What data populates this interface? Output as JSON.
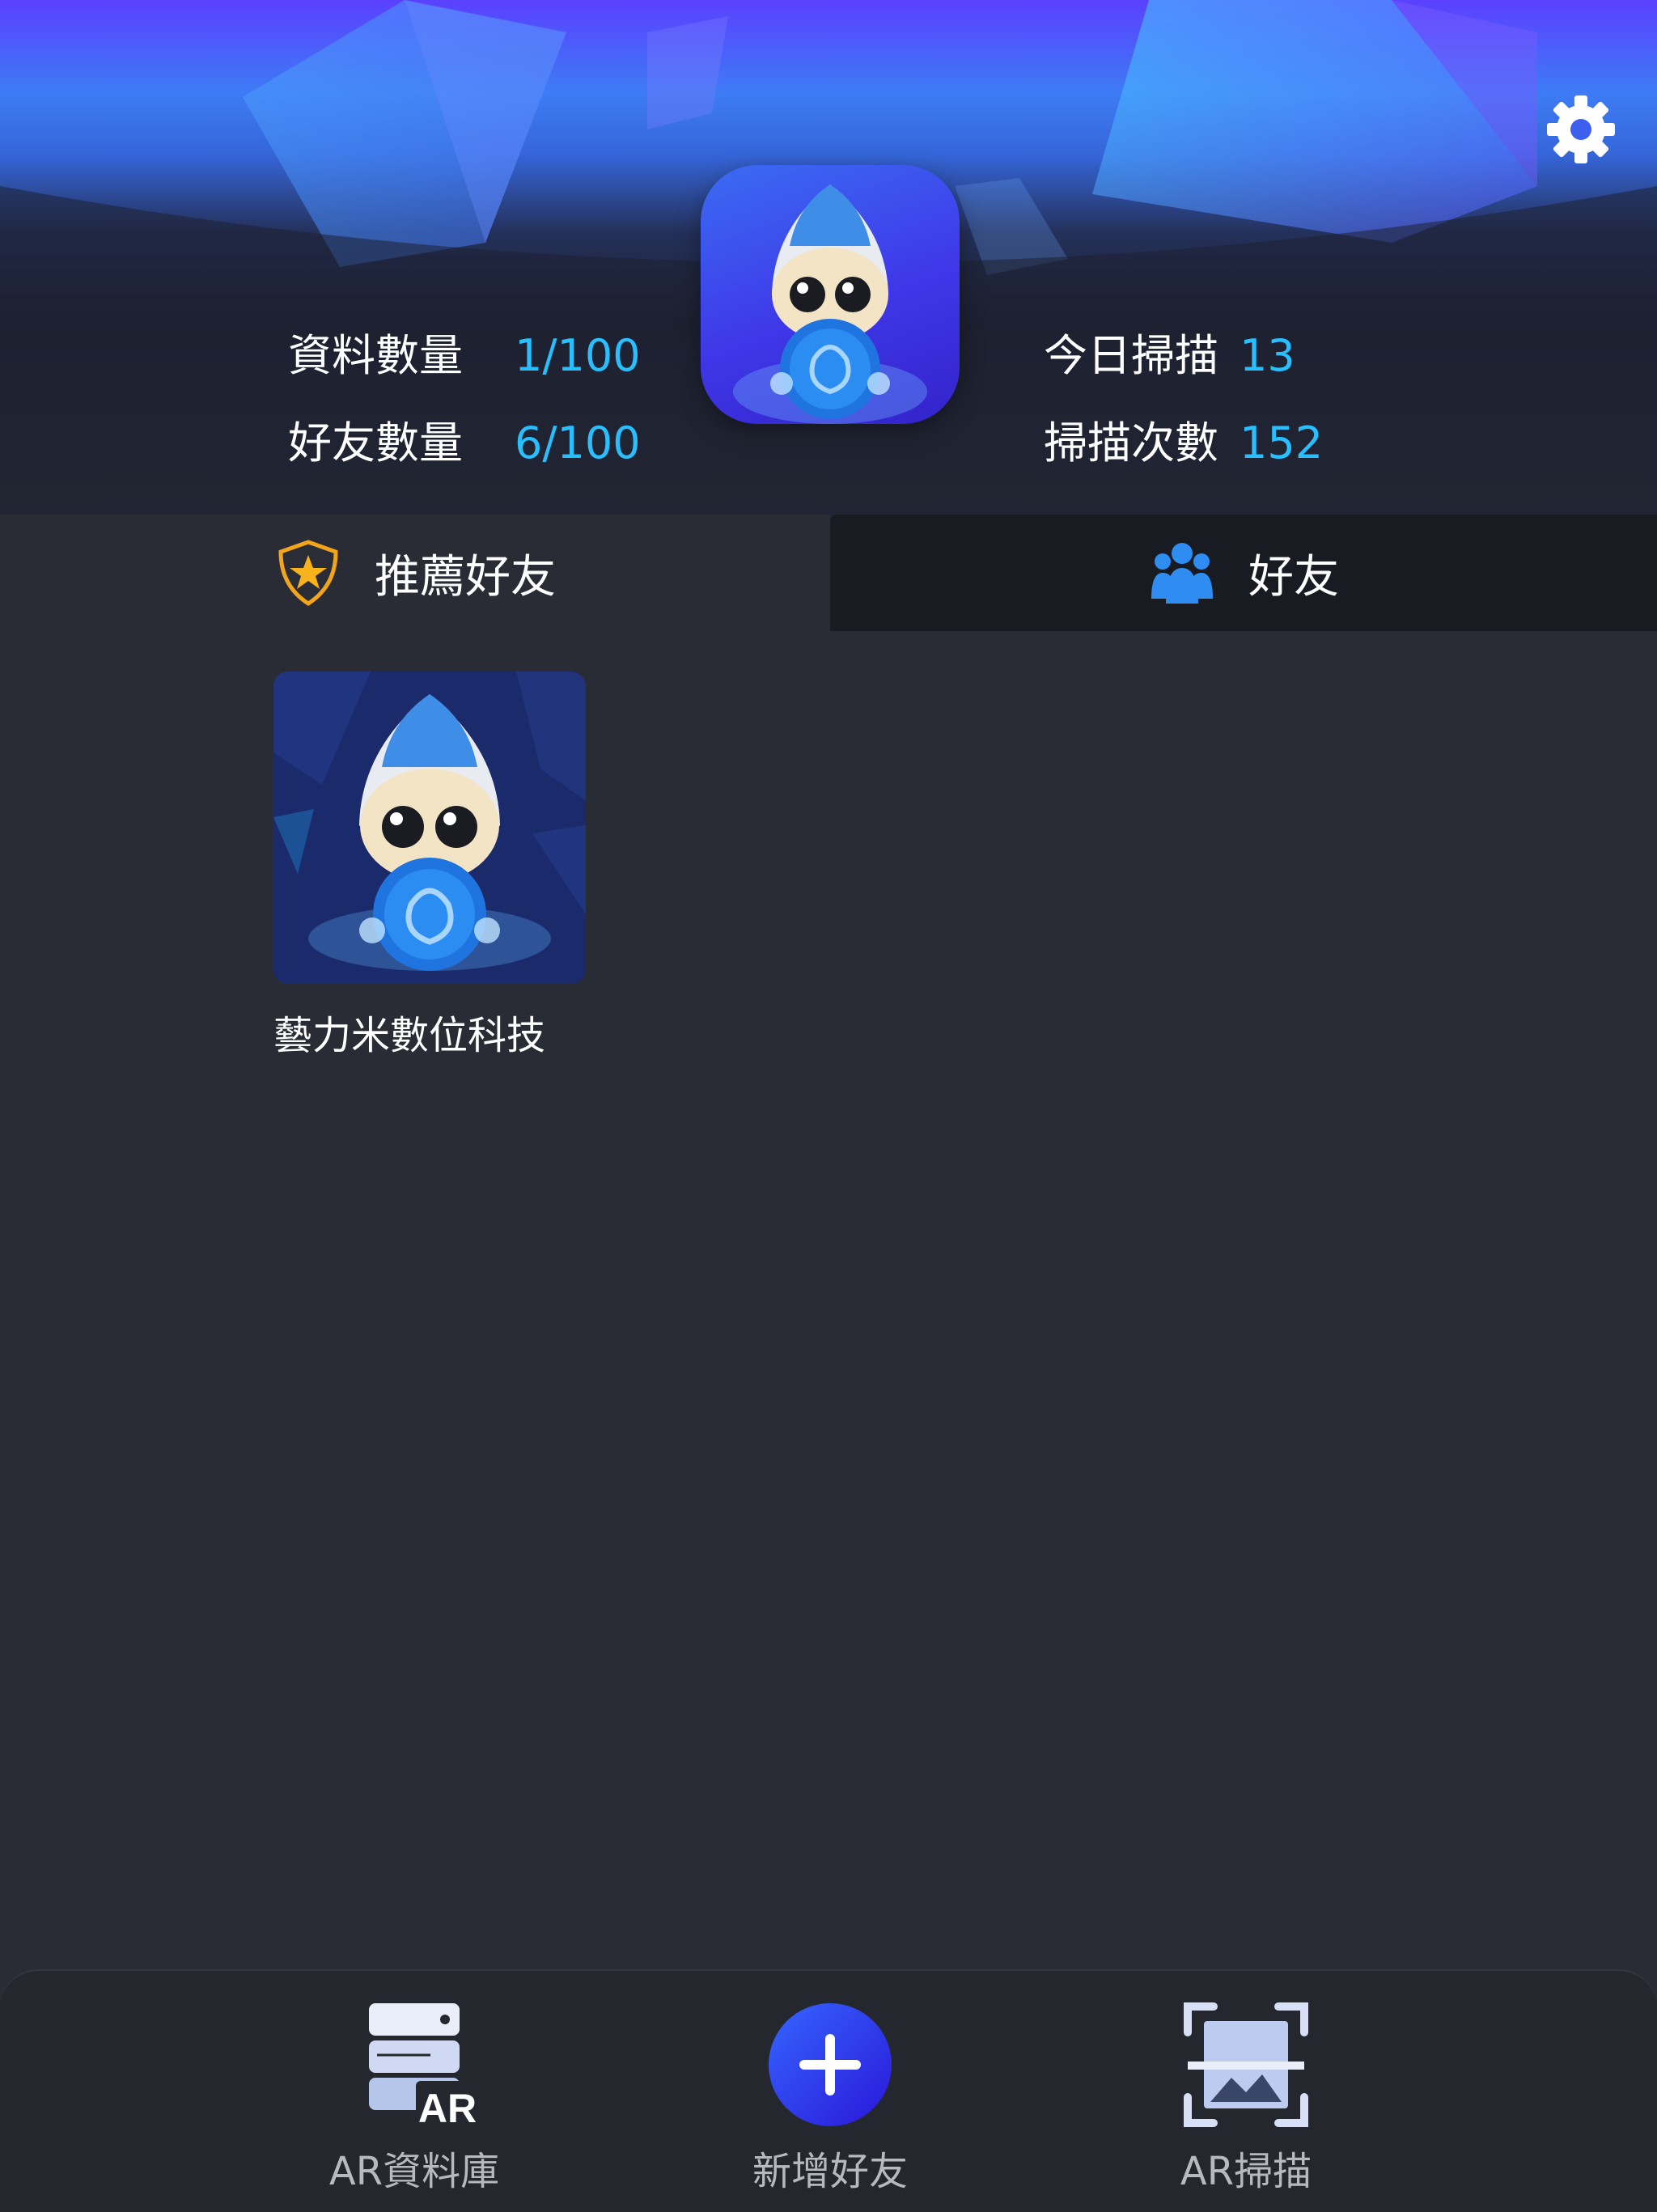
{
  "header": {
    "stats": {
      "data_count_label": "資料數量",
      "data_count_value": "1/100",
      "friend_count_label": "好友數量",
      "friend_count_value": "6/100",
      "today_scan_label": "今日掃描",
      "today_scan_value": "13",
      "scan_times_label": "掃描次數",
      "scan_times_value": "152"
    },
    "settings_icon": "gear-icon",
    "accent_color": "#29bfff"
  },
  "tabs": [
    {
      "label": "推薦好友",
      "icon": "shield-star-icon",
      "selected": true
    },
    {
      "label": "好友",
      "icon": "people-icon",
      "selected": false
    }
  ],
  "friends": [
    {
      "name": "藝力米數位科技",
      "icon": "mascot-avatar"
    }
  ],
  "bottom_nav": [
    {
      "label": "AR資料庫",
      "icon": "ar-database-icon",
      "icon_text": "AR"
    },
    {
      "label": "新增好友",
      "icon": "plus-circle-icon"
    },
    {
      "label": "AR掃描",
      "icon": "scan-frame-icon"
    }
  ]
}
